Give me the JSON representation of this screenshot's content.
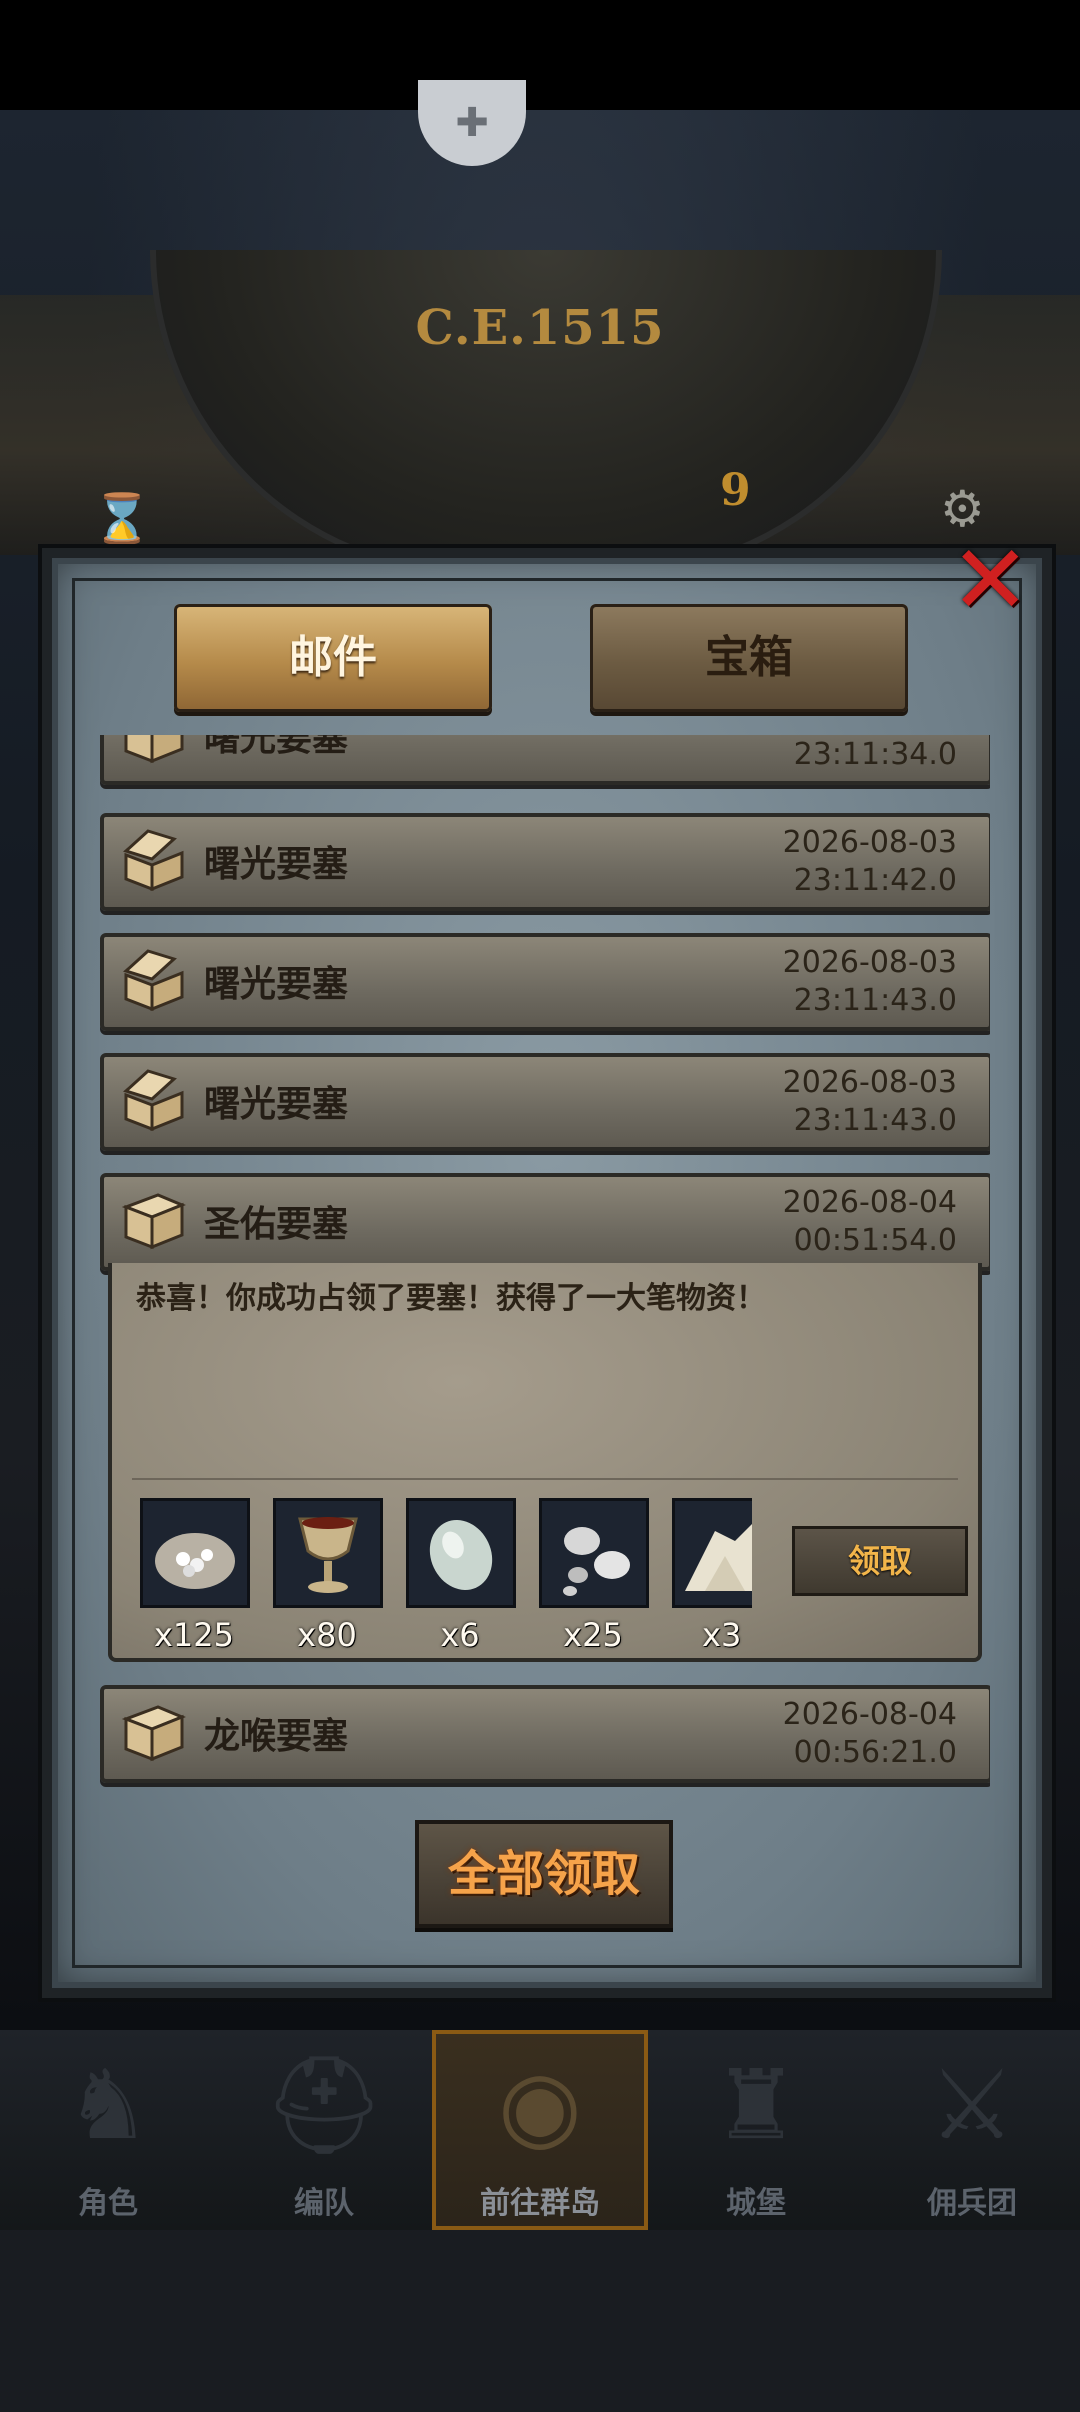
{
  "hud": {
    "era": "C.E.1515",
    "dial_number": "9"
  },
  "dialog": {
    "tabs": [
      {
        "label": "邮件",
        "active": true
      },
      {
        "label": "宝箱",
        "active": false
      }
    ],
    "mails": [
      {
        "sender": "曙光要塞",
        "date": "",
        "time": "23:11:34.0",
        "partial": true
      },
      {
        "sender": "曙光要塞",
        "date": "2026-08-03",
        "time": "23:11:42.0"
      },
      {
        "sender": "曙光要塞",
        "date": "2026-08-03",
        "time": "23:11:43.0"
      },
      {
        "sender": "曙光要塞",
        "date": "2026-08-03",
        "time": "23:11:43.0"
      },
      {
        "sender": "圣佑要塞",
        "date": "2026-08-04",
        "time": "00:51:54.0",
        "expanded": true
      },
      {
        "sender": "龙喉要塞",
        "date": "2026-08-04",
        "time": "00:56:21.0"
      }
    ],
    "expanded_message": "恭喜！你成功占领了要塞！获得了一大笔物资！",
    "rewards": [
      {
        "icon": "gem-sack-icon",
        "qty": "x125"
      },
      {
        "icon": "chalice-icon",
        "qty": "x80"
      },
      {
        "icon": "crystal-stone-icon",
        "qty": "x6"
      },
      {
        "icon": "silver-ore-icon",
        "qty": "x25"
      },
      {
        "icon": "salt-pile-icon",
        "qty": "x3"
      }
    ],
    "claim_label": "领取",
    "claim_all_label": "全部领取"
  },
  "nav": [
    {
      "label": "角色",
      "icon": "knight-icon"
    },
    {
      "label": "编队",
      "icon": "helmet-icon"
    },
    {
      "label": "前往群岛",
      "icon": "island-globe-icon",
      "active": true
    },
    {
      "label": "城堡",
      "icon": "castle-icon"
    },
    {
      "label": "佣兵团",
      "icon": "mercenary-icon"
    }
  ]
}
